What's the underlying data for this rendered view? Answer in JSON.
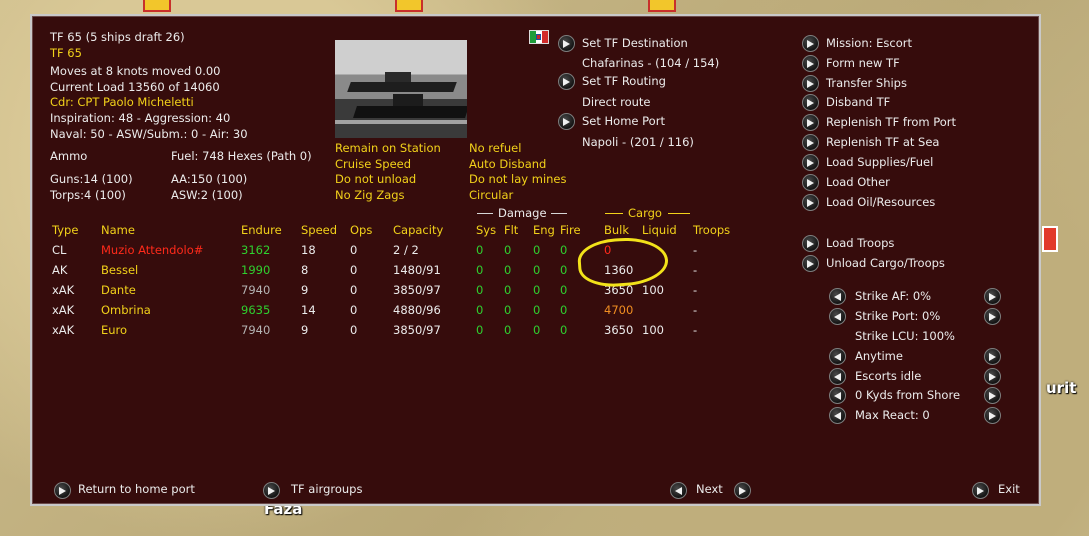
{
  "map": {
    "labels": [
      "Faza",
      "urit"
    ]
  },
  "header": {
    "title": "TF 65 (5 ships draft 26)",
    "tf_name": "TF 65",
    "moves": "Moves at 8 knots moved 0.00",
    "load": "Current Load 13560 of 14060",
    "commander": "Cdr: CPT Paolo Micheletti",
    "inspiration": "Inspiration: 48 - Aggression: 40",
    "naval": "Naval: 50 - ASW/Subm.: 0 - Air: 30",
    "ammo": "Ammo",
    "fuel": "Fuel: 748 Hexes (Path 0)",
    "guns": "Guns:14 (100)",
    "aa": "AA:150 (100)",
    "torps": "Torps:4 (100)",
    "asw": "ASW:2 (100)"
  },
  "flag_icon": "italy-flag-icon",
  "options": {
    "left": [
      "Remain on Station",
      "Cruise Speed",
      "Do not unload",
      "No Zig Zags"
    ],
    "right": [
      "No refuel",
      "Auto Disband",
      "Do not lay mines",
      "Circular"
    ]
  },
  "destination": {
    "set_destination": "Set TF Destination",
    "destination_value": "Chafarinas - (104 / 154)",
    "set_routing": "Set TF Routing",
    "routing_value": "Direct route",
    "set_home": "Set Home Port",
    "home_value": "Napoli - (201 / 116)"
  },
  "actions": [
    "Mission: Escort",
    "Form new TF",
    "Transfer Ships",
    "Disband TF",
    "Replenish TF from Port",
    "Replenish TF at Sea",
    "Load Supplies/Fuel",
    "Load Other",
    "Load Oil/Resources"
  ],
  "troop_actions": [
    "Load Troops",
    "Unload Cargo/Troops"
  ],
  "strike": {
    "af": "Strike AF: 0%",
    "port": "Strike Port: 0%",
    "lcu": "Strike LCU: 100%",
    "time": "Anytime",
    "escorts": "Escorts idle",
    "shore": "0 Kyds from Shore",
    "react": "Max React: 0"
  },
  "table": {
    "group_damage": "Damage",
    "group_cargo": "Cargo",
    "headers": [
      "Type",
      "Name",
      "Endure",
      "Speed",
      "Ops",
      "Capacity",
      "Sys",
      "Flt",
      "Eng",
      "Fire",
      "Bulk",
      "Liquid",
      "Troops"
    ],
    "rows": [
      {
        "type": "CL",
        "name": "Muzio Attendolo#",
        "endure": "3162",
        "speed": "18",
        "ops": "0",
        "capacity": "2 / 2",
        "sys": "0",
        "flt": "0",
        "eng": "0",
        "fire": "0",
        "bulk": "0",
        "liquid": "",
        "troops": "-"
      },
      {
        "type": "AK",
        "name": "Bessel",
        "endure": "1990",
        "speed": "8",
        "ops": "0",
        "capacity": "1480/91",
        "sys": "0",
        "flt": "0",
        "eng": "0",
        "fire": "0",
        "bulk": "1360",
        "liquid": "",
        "troops": "-"
      },
      {
        "type": "xAK",
        "name": "Dante",
        "endure": "7940",
        "speed": "9",
        "ops": "0",
        "capacity": "3850/97",
        "sys": "0",
        "flt": "0",
        "eng": "0",
        "fire": "0",
        "bulk": "3650",
        "liquid": "100",
        "troops": "-"
      },
      {
        "type": "xAK",
        "name": "Ombrina",
        "endure": "9635",
        "speed": "14",
        "ops": "0",
        "capacity": "4880/96",
        "sys": "0",
        "flt": "0",
        "eng": "0",
        "fire": "0",
        "bulk": "4700",
        "liquid": "",
        "troops": "-"
      },
      {
        "type": "xAK",
        "name": "Euro",
        "endure": "7940",
        "speed": "9",
        "ops": "0",
        "capacity": "3850/97",
        "sys": "0",
        "flt": "0",
        "eng": "0",
        "fire": "0",
        "bulk": "3650",
        "liquid": "100",
        "troops": "-"
      }
    ]
  },
  "footer": {
    "return_home": "Return to home port",
    "airgroups": "TF airgroups",
    "next": "Next",
    "exit": "Exit"
  },
  "colors": {
    "panel_bg": "#360c0c",
    "yellow": "#f2d21a",
    "green": "#2fd12f",
    "red": "#ff2a1a",
    "orange": "#f08e22",
    "gray": "#b5b5b5"
  }
}
